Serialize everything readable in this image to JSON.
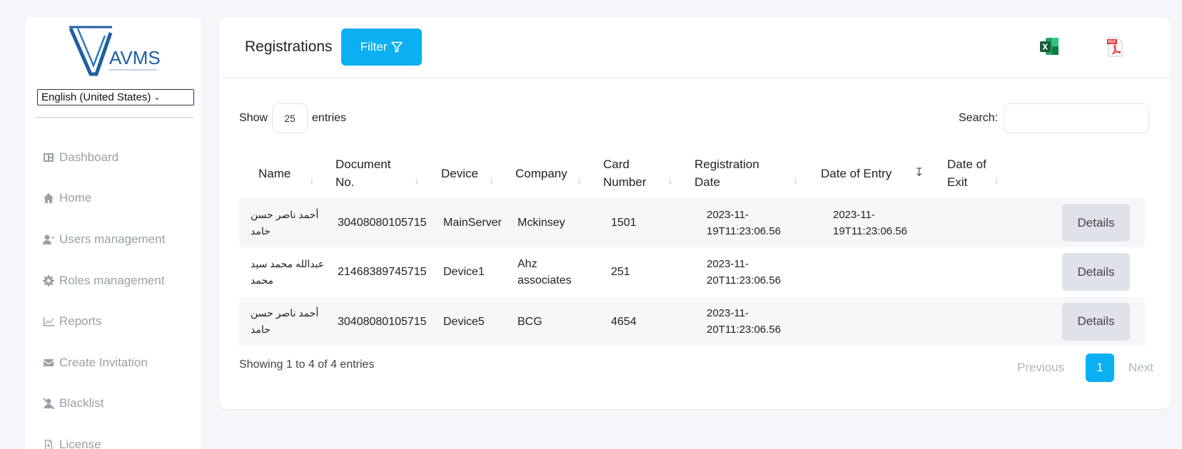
{
  "sidebar": {
    "language": "English (United States)",
    "items": [
      {
        "label": "Dashboard",
        "icon": "dashboard-icon"
      },
      {
        "label": "Home",
        "icon": "home-icon"
      },
      {
        "label": "Users management",
        "icon": "user-plus-icon"
      },
      {
        "label": "Roles management",
        "icon": "gear-icon"
      },
      {
        "label": "Reports",
        "icon": "chart-icon"
      },
      {
        "label": "Create Invitation",
        "icon": "envelope-icon"
      },
      {
        "label": "Blacklist",
        "icon": "user-slash-icon"
      },
      {
        "label": "License",
        "icon": "file-download-icon"
      }
    ]
  },
  "header": {
    "title": "Registrations",
    "filter_label": "Filter"
  },
  "table_controls": {
    "show_label": "Show",
    "page_length": "25",
    "entries_label": "entries",
    "search_label": "Search:"
  },
  "table": {
    "columns": [
      "Name",
      "Document No.",
      "Device",
      "Company",
      "Card Number",
      "Registration Date",
      "Date of Entry",
      "Date of Exit",
      ""
    ],
    "rows": [
      {
        "name": "أحمد ناصر حسن حامد",
        "document_no": "30408080105715",
        "device": "MainServer",
        "company": "Mckinsey",
        "card_number": "1501",
        "registration_date": "2023-11-19T11:23:06.56",
        "date_of_entry": "2023-11-19T11:23:06.56",
        "date_of_exit": "",
        "action": "Details"
      },
      {
        "name": "عبدالله محمد سيد محمد",
        "document_no": "21468389745715",
        "device": "Device1",
        "company": "Ahz associates",
        "card_number": "251",
        "registration_date": "2023-11-20T11:23:06.56",
        "date_of_entry": "",
        "date_of_exit": "",
        "action": "Details"
      },
      {
        "name": "أحمد ناصر حسن حامد",
        "document_no": "30408080105715",
        "device": "Device5",
        "company": "BCG",
        "card_number": "4654",
        "registration_date": "2023-11-20T11:23:06.56",
        "date_of_entry": "",
        "date_of_exit": "",
        "action": "Details"
      }
    ]
  },
  "footer": {
    "info": "Showing 1 to 4 of 4 entries",
    "previous": "Previous",
    "current_page": "1",
    "next": "Next"
  },
  "colors": {
    "accent": "#0ab0f2",
    "excel": "#1e7145",
    "pdf": "#d9322d"
  }
}
